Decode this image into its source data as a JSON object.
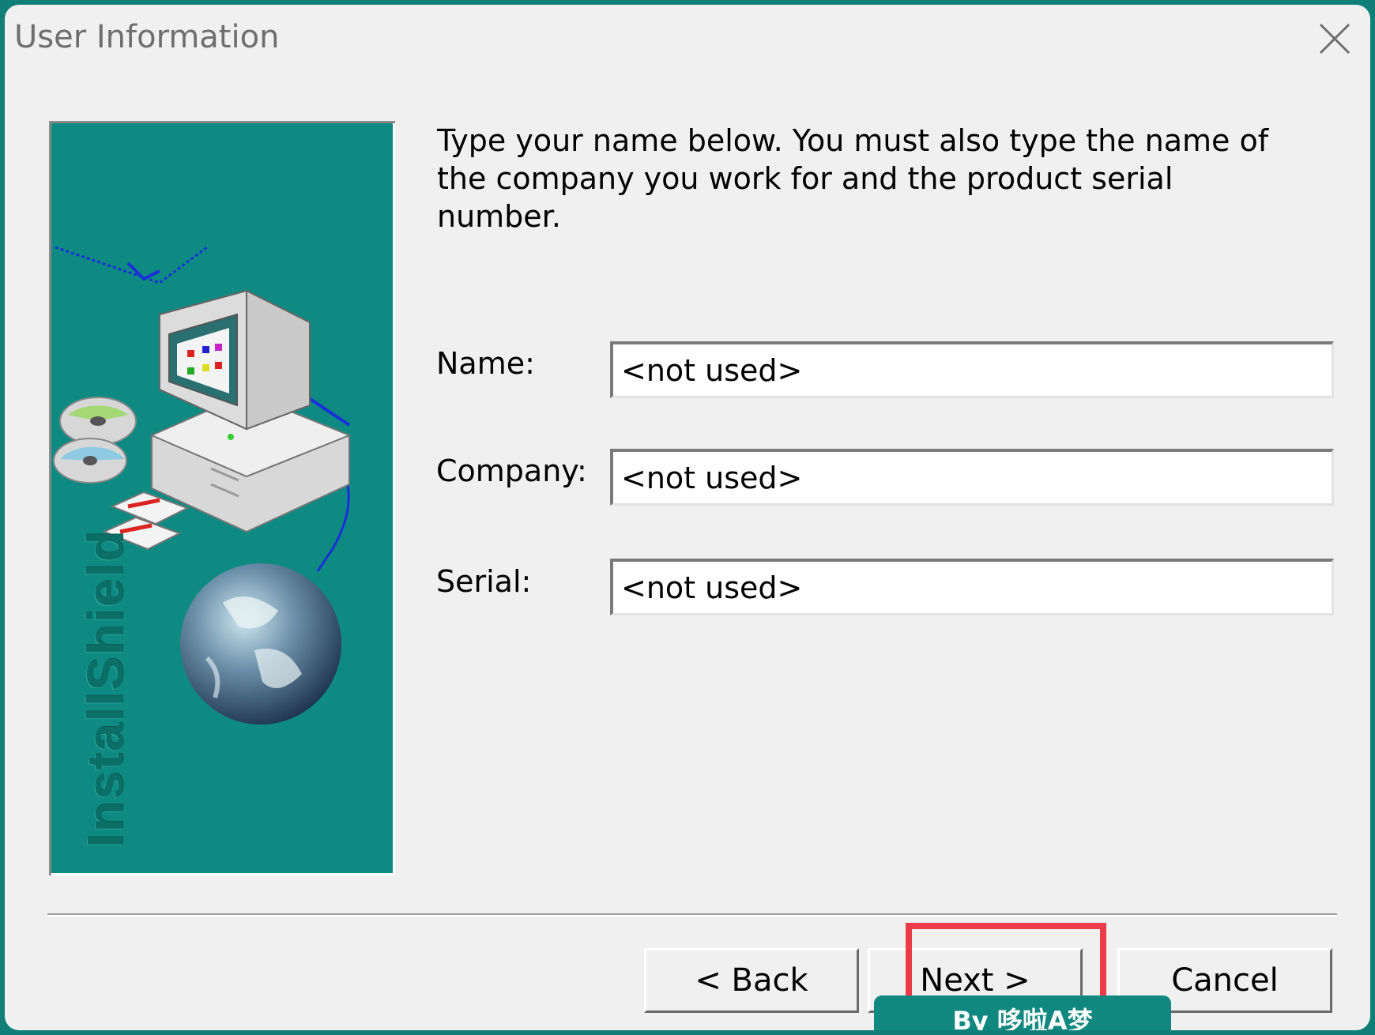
{
  "window": {
    "title": "User Information"
  },
  "panel": {
    "brand_text": "InstallShield"
  },
  "instruction_text": "Type your name below. You must also type the name of the company you work for and the product serial number.",
  "form": {
    "name": {
      "label": "Name:",
      "value": "<not used>"
    },
    "company": {
      "label": "Company:",
      "value": "<not used>"
    },
    "serial": {
      "label": "Serial:",
      "value": "<not used>"
    }
  },
  "buttons": {
    "back": "< Back",
    "next": "Next >",
    "cancel": "Cancel"
  },
  "watermark": "By 哆啦A梦",
  "colors": {
    "desktop": "#0f7f77",
    "panel": "#0f8a82",
    "highlight": "#ee3b48"
  }
}
